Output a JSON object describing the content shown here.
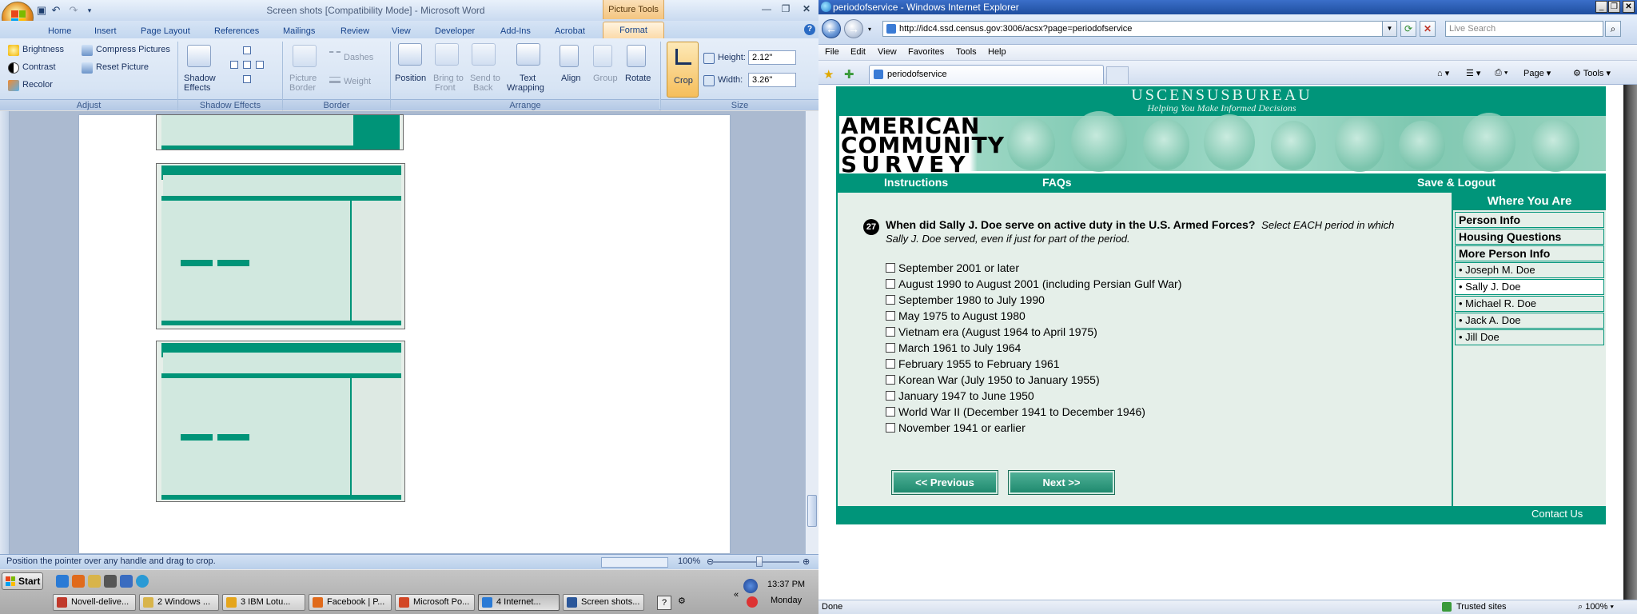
{
  "word": {
    "title": "Screen shots [Compatibility Mode] - Microsoft Word",
    "contextual_group": "Picture Tools",
    "tabs": [
      "Home",
      "Insert",
      "Page Layout",
      "References",
      "Mailings",
      "Review",
      "View",
      "Developer",
      "Add-Ins",
      "Acrobat"
    ],
    "active_tab": "Format",
    "ribbon": {
      "adjust": {
        "brightness": "Brightness",
        "contrast": "Contrast",
        "recolor": "Recolor",
        "compress": "Compress Pictures",
        "reset": "Reset Picture",
        "label": "Adjust"
      },
      "shadow": {
        "button_line1": "Shadow",
        "button_line2": "Effects",
        "label": "Shadow Effects"
      },
      "border": {
        "button_line1": "Picture",
        "button_line2": "Border",
        "dashes": "Dashes",
        "weight": "Weight",
        "label": "Border"
      },
      "arrange": {
        "position": "Position",
        "bring_front_l1": "Bring to",
        "bring_front_l2": "Front",
        "send_back_l1": "Send to",
        "send_back_l2": "Back",
        "text_wrap_l1": "Text",
        "text_wrap_l2": "Wrapping",
        "align": "Align",
        "group": "Group",
        "rotate": "Rotate",
        "label": "Arrange"
      },
      "size": {
        "crop": "Crop",
        "height_label": "Height:",
        "height_value": "2.12\"",
        "width_label": "Width:",
        "width_value": "3.26\"",
        "label": "Size"
      }
    },
    "status_text": "Position the pointer over any handle and drag to crop.",
    "zoom": "100%"
  },
  "taskbar": {
    "start": "Start",
    "tasks": [
      "Novell-delive...",
      "2 Windows ...",
      "3 IBM Lotu...",
      "Facebook | P...",
      "Microsoft Po...",
      "4 Internet...",
      "Screen shots..."
    ],
    "active_task_index": 5,
    "time": "13:37 PM",
    "day": "Monday"
  },
  "ie": {
    "title": "periodofservice - Windows Internet Explorer",
    "address": "http://idc4.ssd.census.gov:3006/acsx?page=periodofservice",
    "search_placeholder": "Live Search",
    "menu": [
      "File",
      "Edit",
      "View",
      "Favorites",
      "Tools",
      "Help"
    ],
    "tab_title": "periodofservice",
    "cmd": {
      "page": "Page",
      "tools": "Tools"
    },
    "status_left": "Done",
    "status_zone": "Trusted sites",
    "status_zoom": "100%"
  },
  "census": {
    "bureau": "USCENSUSBUREAU",
    "tagline": "Helping You Make Informed Decisions",
    "logo_lines": [
      "AMERICAN",
      "COMMUNITY",
      "SURVEY"
    ],
    "nav": {
      "instructions": "Instructions",
      "faqs": "FAQs",
      "save_logout": "Save & Logout"
    },
    "question": {
      "number": "27",
      "text": "When did Sally J. Doe serve on active duty in the U.S. Armed Forces?",
      "instruction": "Select EACH period in which Sally J. Doe served, even if just for part of the period."
    },
    "options": [
      "September 2001 or later",
      "August 1990 to August 2001 (including Persian Gulf War)",
      "September 1980 to July 1990",
      "May 1975 to August 1980",
      "Vietnam era (August 1964 to April 1975)",
      "March 1961 to July 1964",
      "February 1955 to February 1961",
      "Korean War (July 1950 to January 1955)",
      "January 1947 to June 1950",
      "World War II (December 1941 to December 1946)",
      "November 1941 or earlier"
    ],
    "buttons": {
      "previous": "<<  Previous",
      "next": "Next  >>"
    },
    "where_title": "Where You Are",
    "where_items": [
      {
        "label": "Person Info",
        "section": true
      },
      {
        "label": "Housing Questions",
        "section": true
      },
      {
        "label": "More Person Info",
        "section": true
      },
      {
        "label": "• Joseph M. Doe",
        "section": false
      },
      {
        "label": "• Sally J. Doe",
        "section": false,
        "current": true
      },
      {
        "label": "• Michael R. Doe",
        "section": false
      },
      {
        "label": "• Jack A. Doe",
        "section": false
      },
      {
        "label": "• Jill Doe",
        "section": false
      }
    ],
    "contact": "Contact Us"
  }
}
